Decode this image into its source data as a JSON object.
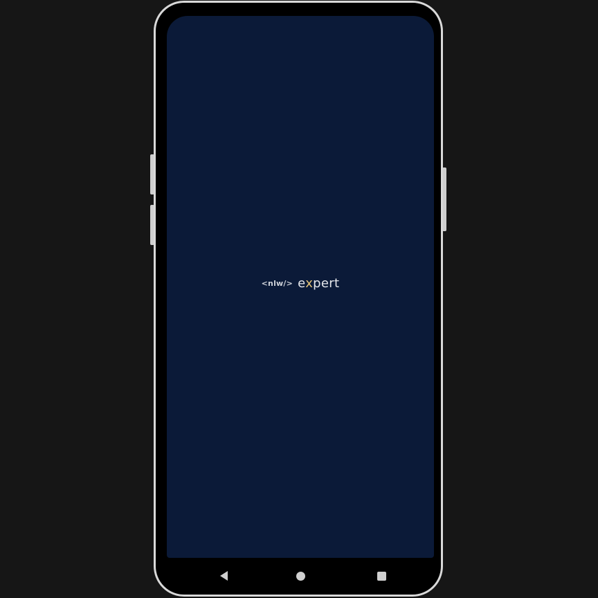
{
  "device": {
    "type": "android-phone",
    "frame_color": "#d9d9d9",
    "screen_background": "#0b1a38"
  },
  "splash": {
    "logo_tag": "<nlw/>",
    "logo_word_prefix": "e",
    "logo_word_mark": "x",
    "logo_word_suffix": "pert",
    "accent_color": "#e3c277"
  },
  "navigation": {
    "back_icon": "back-triangle",
    "home_icon": "home-circle",
    "recents_icon": "recents-square"
  }
}
